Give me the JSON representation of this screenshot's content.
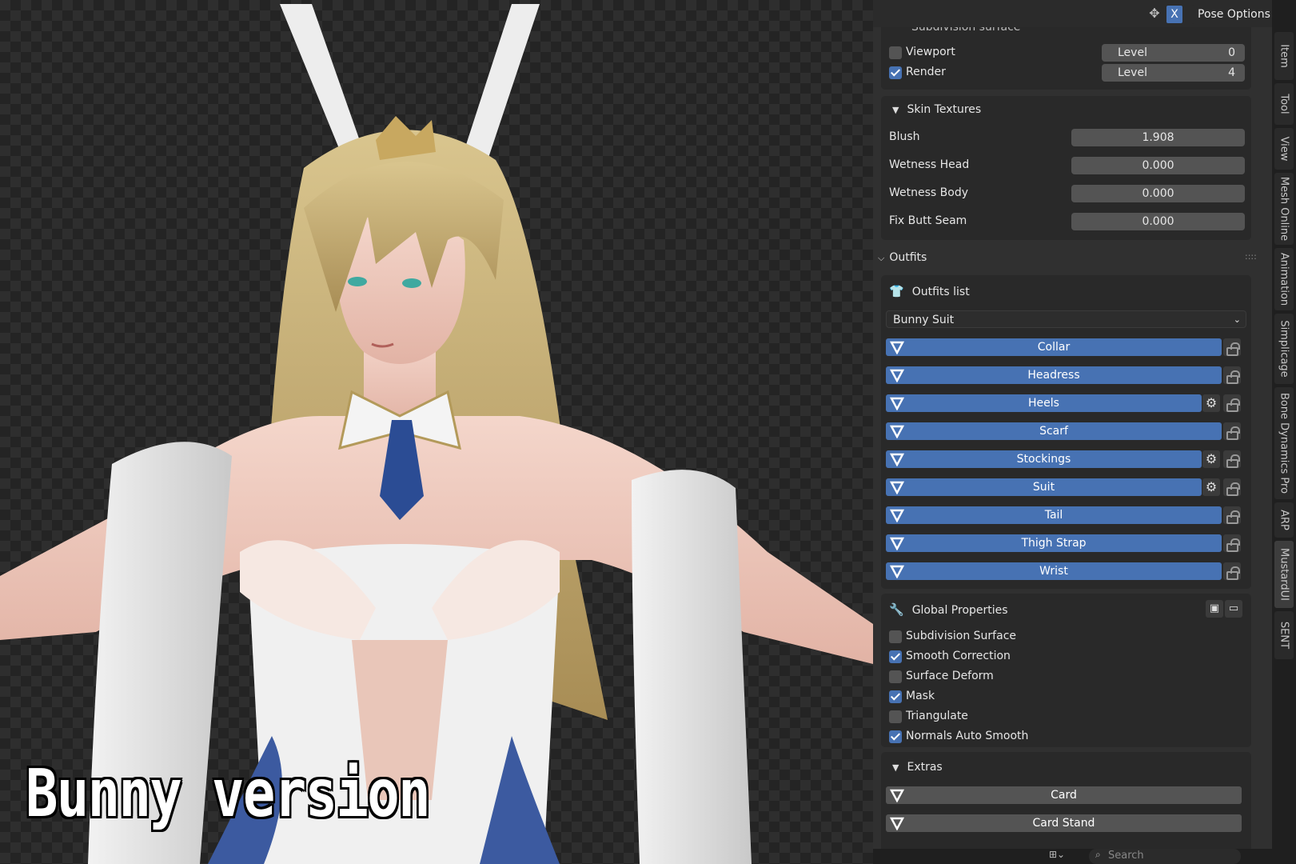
{
  "caption": "Bunny version",
  "header": {
    "x_label": "X",
    "pose_options": "Pose Options"
  },
  "subdiv": {
    "title": "Subdivision surface",
    "viewport": {
      "label": "Viewport",
      "checked": false,
      "level_label": "Level",
      "level": "0"
    },
    "render": {
      "label": "Render",
      "checked": true,
      "level_label": "Level",
      "level": "4"
    }
  },
  "skin": {
    "title": "Skin Textures",
    "rows": [
      {
        "label": "Blush",
        "value": "1.908"
      },
      {
        "label": "Wetness Head",
        "value": "0.000"
      },
      {
        "label": "Wetness Body",
        "value": "0.000"
      },
      {
        "label": "Fix Butt Seam",
        "value": "0.000"
      }
    ]
  },
  "outfits": {
    "title": "Outfits",
    "list_label": "Outfits list",
    "selected": "Bunny Suit",
    "items": [
      {
        "label": "Collar",
        "gear": false
      },
      {
        "label": "Headress",
        "gear": false
      },
      {
        "label": "Heels",
        "gear": true
      },
      {
        "label": "Scarf",
        "gear": false
      },
      {
        "label": "Stockings",
        "gear": true
      },
      {
        "label": "Suit",
        "gear": true
      },
      {
        "label": "Tail",
        "gear": false
      },
      {
        "label": "Thigh Strap",
        "gear": false
      },
      {
        "label": "Wrist",
        "gear": false
      }
    ]
  },
  "global": {
    "title": "Global Properties",
    "options": [
      {
        "label": "Subdivision Surface",
        "checked": false
      },
      {
        "label": "Smooth Correction",
        "checked": true
      },
      {
        "label": "Surface Deform",
        "checked": false
      },
      {
        "label": "Mask",
        "checked": true
      },
      {
        "label": "Triangulate",
        "checked": false
      },
      {
        "label": "Normals Auto Smooth",
        "checked": true
      }
    ]
  },
  "extras": {
    "title": "Extras",
    "items": [
      {
        "label": "Card"
      },
      {
        "label": "Card Stand"
      }
    ]
  },
  "footer": {
    "search_placeholder": "Search"
  },
  "tabs": [
    "Item",
    "Tool",
    "View",
    "Mesh Online",
    "Animation",
    "Simplicage",
    "Bone Dynamics Pro",
    "ARP",
    "MustardUI",
    "SENT"
  ],
  "active_tab": "MustardUI",
  "colors": {
    "accent": "#4772b3",
    "panel_bg": "#303030",
    "box_bg": "#292929",
    "field_bg": "#545454"
  }
}
